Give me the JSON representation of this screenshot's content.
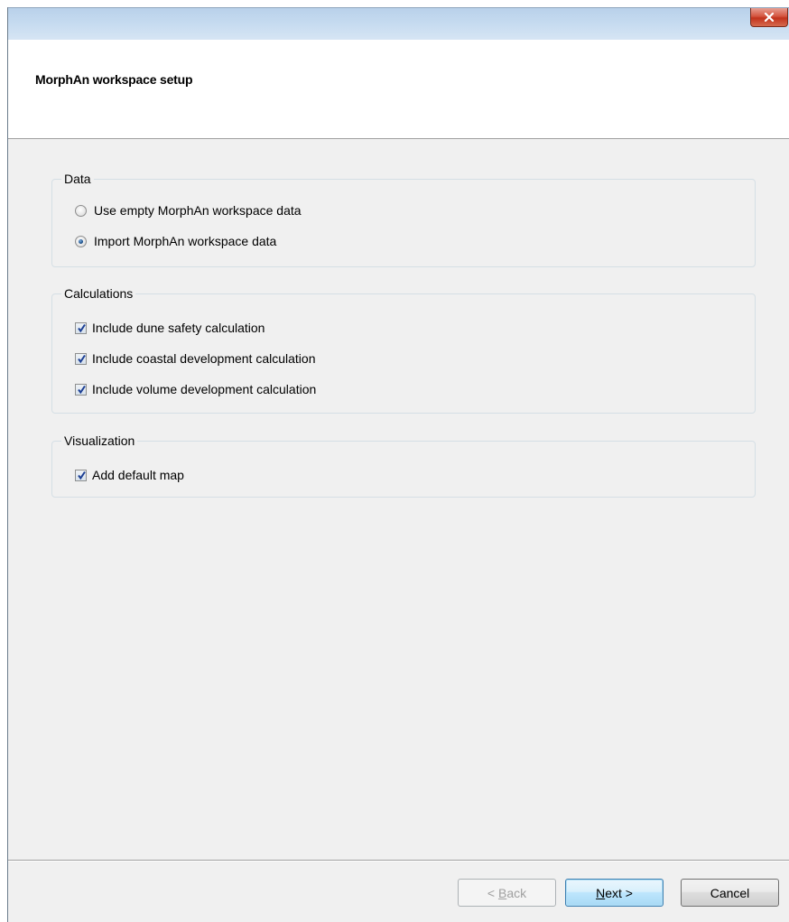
{
  "window": {
    "close_icon": "close-icon",
    "header_title": "MorphAn workspace setup"
  },
  "groups": {
    "data": {
      "label": "Data",
      "options": [
        {
          "label": "Use empty MorphAn workspace data",
          "selected": false
        },
        {
          "label": "Import MorphAn workspace data",
          "selected": true
        }
      ]
    },
    "calculations": {
      "label": "Calculations",
      "options": [
        {
          "label": "Include dune safety calculation",
          "checked": true
        },
        {
          "label": "Include coastal development calculation",
          "checked": true
        },
        {
          "label": "Include volume development calculation",
          "checked": true
        }
      ]
    },
    "visualization": {
      "label": "Visualization",
      "options": [
        {
          "label": "Add default map",
          "checked": true
        }
      ]
    }
  },
  "buttons": {
    "back": {
      "prefix": "< ",
      "mnemonic": "B",
      "rest": "ack",
      "enabled": false
    },
    "next": {
      "mnemonic": "N",
      "rest": "ext >",
      "enabled": true
    },
    "cancel": {
      "label": "Cancel",
      "enabled": true
    }
  },
  "colors": {
    "close_button": "#c2331c",
    "checkmark": "#1c3f94",
    "default_button_border": "#3c7fb1"
  }
}
